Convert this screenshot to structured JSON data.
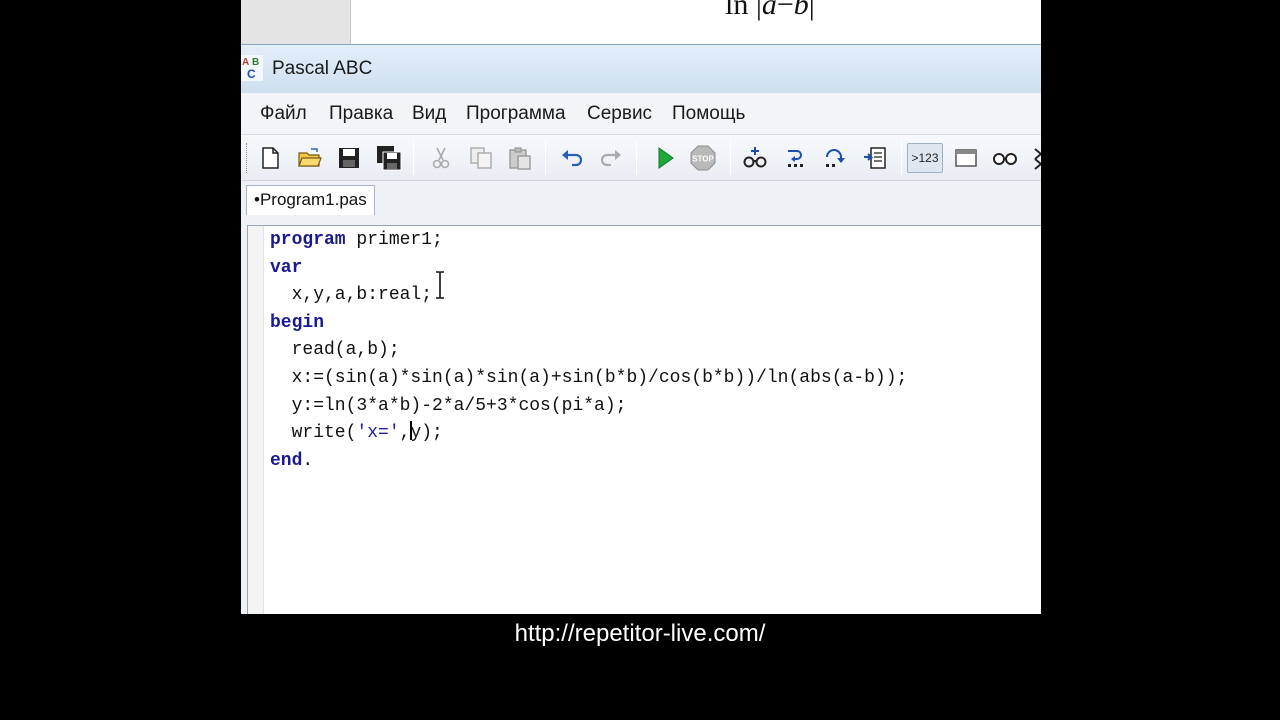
{
  "background_formula": {
    "prefix": "ln |",
    "var_a": "a",
    "minus": "−",
    "var_b": "b",
    "suffix": "|"
  },
  "window": {
    "title": "Pascal ABC",
    "icon": "pascal-abc-app-icon"
  },
  "menu": {
    "items": [
      {
        "label": "Файл"
      },
      {
        "label": "Правка"
      },
      {
        "label": "Вид"
      },
      {
        "label": "Программа"
      },
      {
        "label": "Сервис"
      },
      {
        "label": "Помощь"
      }
    ]
  },
  "toolbar": {
    "buttons": [
      {
        "icon": "new-file-icon"
      },
      {
        "icon": "open-folder-icon"
      },
      {
        "icon": "save-icon"
      },
      {
        "icon": "save-all-icon"
      },
      {
        "icon": "cut-icon"
      },
      {
        "icon": "copy-icon"
      },
      {
        "icon": "paste-icon"
      },
      {
        "icon": "undo-icon"
      },
      {
        "icon": "redo-icon"
      },
      {
        "icon": "run-icon"
      },
      {
        "icon": "stop-icon",
        "label": "STOP"
      },
      {
        "icon": "add-watch-icon"
      },
      {
        "icon": "step-into-icon"
      },
      {
        "icon": "step-over-icon"
      },
      {
        "icon": "run-to-cursor-icon"
      },
      {
        "icon": "output-window-icon",
        "label": ">123"
      },
      {
        "icon": "window-icon"
      },
      {
        "icon": "glasses-icon"
      }
    ]
  },
  "tabs": [
    {
      "label": "•Program1.pas"
    }
  ],
  "editor": {
    "lines": [
      [
        {
          "t": "program",
          "k": "kw"
        },
        {
          "t": " primer1;"
        }
      ],
      [
        {
          "t": "var",
          "k": "kw"
        }
      ],
      [
        {
          "t": "  x,y,a,b:real;"
        }
      ],
      [
        {
          "t": "begin",
          "k": "kw"
        }
      ],
      [
        {
          "t": "  read(a,b);"
        }
      ],
      [
        {
          "t": "  x:=(sin(a)*sin(a)*sin(a)+sin(b*b)/cos(b*b))/ln(abs(a-b));"
        }
      ],
      [
        {
          "t": "  y:=ln(3*a*b)-2*a/5+3*cos(pi*a);"
        }
      ],
      [
        {
          "t": "  write("
        },
        {
          "t": "'x='",
          "k": "str"
        },
        {
          "t": ","
        },
        {
          "caret": true
        },
        {
          "t": "y);"
        }
      ],
      [
        {
          "t": "end",
          "k": "kw"
        },
        {
          "t": "."
        }
      ]
    ]
  },
  "caption": {
    "url": "http://repetitor-live.com/"
  },
  "colors": {
    "keyword": "#1a1a90",
    "string": "#1d1da8",
    "title_bar": "#d9e6f4",
    "background": "#000000"
  }
}
